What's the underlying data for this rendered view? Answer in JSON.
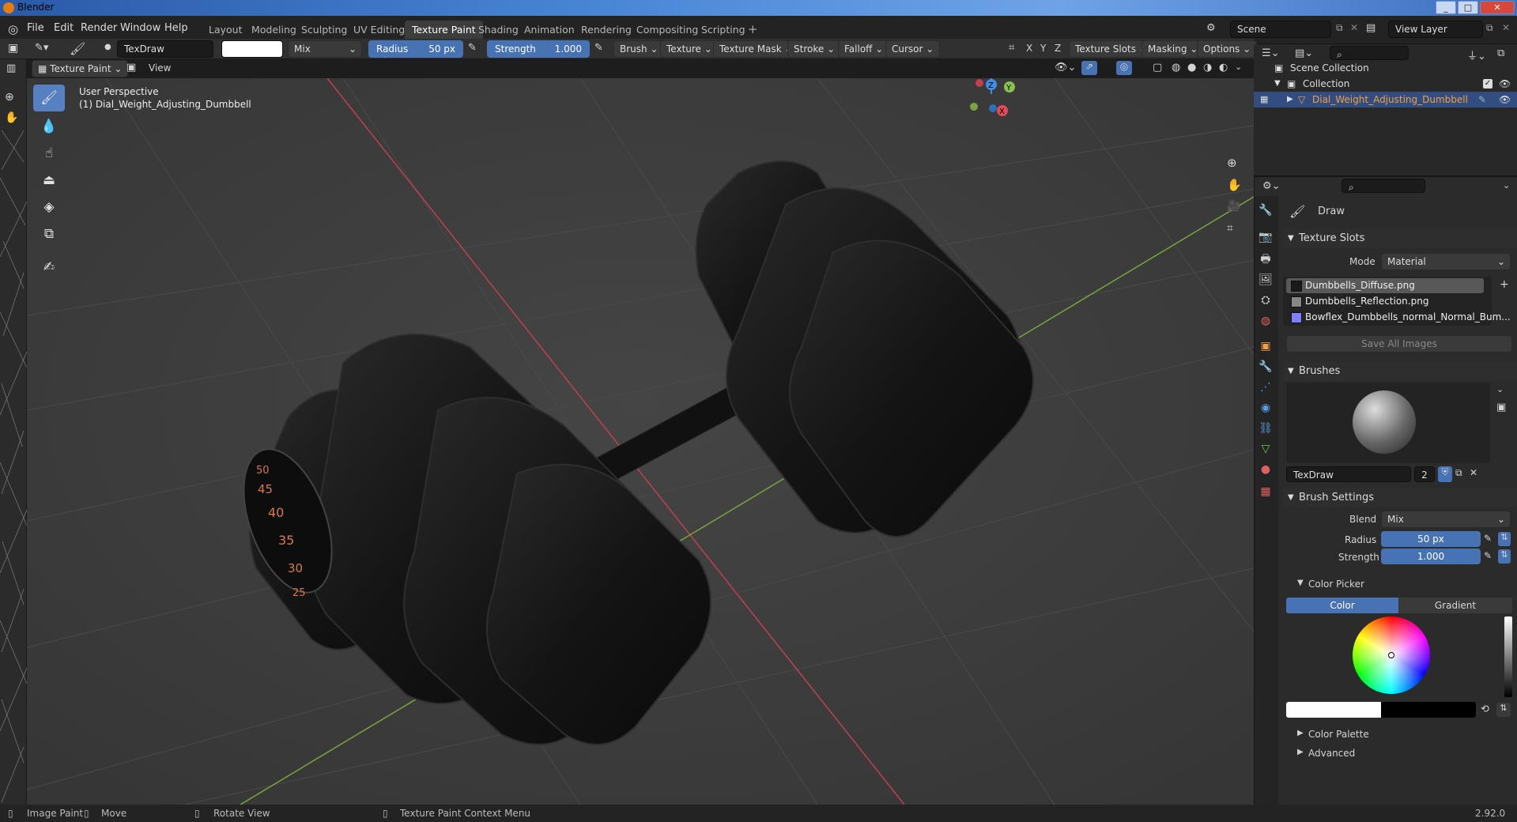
{
  "window": {
    "title": "Blender"
  },
  "menu": [
    "File",
    "Edit",
    "Render",
    "Window",
    "Help"
  ],
  "workspaces": [
    "Layout",
    "Modeling",
    "Sculpting",
    "UV Editing",
    "Texture Paint",
    "Shading",
    "Animation",
    "Rendering",
    "Compositing",
    "Scripting"
  ],
  "active_workspace": "Texture Paint",
  "top_right": {
    "scene": "Scene",
    "view_layer": "View Layer"
  },
  "tool_header": {
    "brush_name": "TexDraw",
    "blend": "Mix",
    "radius_label": "Radius",
    "radius_value": "50 px",
    "strength_label": "Strength",
    "strength_value": "1.000",
    "menus": [
      "Brush",
      "Texture",
      "Texture Mask",
      "Stroke",
      "Falloff",
      "Cursor"
    ],
    "axis": [
      "X",
      "Y",
      "Z"
    ],
    "right_menus": [
      "Texture Slots",
      "Masking",
      "Options"
    ]
  },
  "viewport_header": {
    "mode": "Texture Paint",
    "view": "View"
  },
  "viewport": {
    "perspective": "User Perspective",
    "object": "(1) Dial_Weight_Adjusting_Dumbbell",
    "dial_numbers": [
      "45",
      "40",
      "35",
      "30",
      "25",
      "50"
    ],
    "gizmo": {
      "z": "Z",
      "y": "Y",
      "x": "X"
    }
  },
  "outliner": {
    "scene_collection": "Scene Collection",
    "collection": "Collection",
    "object": "Dial_Weight_Adjusting_Dumbbell"
  },
  "properties": {
    "tool_name": "Draw",
    "texture_slots": {
      "title": "Texture Slots",
      "mode_label": "Mode",
      "mode_value": "Material",
      "slots": [
        {
          "name": "Dumbbells_Diffuse.png",
          "color": "#1a1a1a"
        },
        {
          "name": "Dumbbells_Reflection.png",
          "color": "#888888"
        },
        {
          "name": "Bowflex_Dumbbells_normal_Normal_Bum...",
          "color": "#8080ff"
        }
      ],
      "save_all": "Save All Images"
    },
    "brushes": {
      "title": "Brushes",
      "name": "TexDraw",
      "users": "2"
    },
    "brush_settings": {
      "title": "Brush Settings",
      "blend_label": "Blend",
      "blend_value": "Mix",
      "radius_label": "Radius",
      "radius_value": "50 px",
      "strength_label": "Strength",
      "strength_value": "1.000"
    },
    "color_picker": {
      "title": "Color Picker",
      "color_tab": "Color",
      "gradient_tab": "Gradient"
    },
    "color_palette": "Color Palette",
    "advanced": "Advanced"
  },
  "statusbar": {
    "items": [
      "Image Paint",
      "Move",
      "Rotate View",
      "Texture Paint Context Menu"
    ],
    "version": "2.92.0"
  },
  "colors": {
    "accent": "#4772b3",
    "selection": "#f0a040",
    "x_axis": "#e34a5a",
    "y_axis": "#8bc34a",
    "z_axis": "#3d8fe8"
  }
}
